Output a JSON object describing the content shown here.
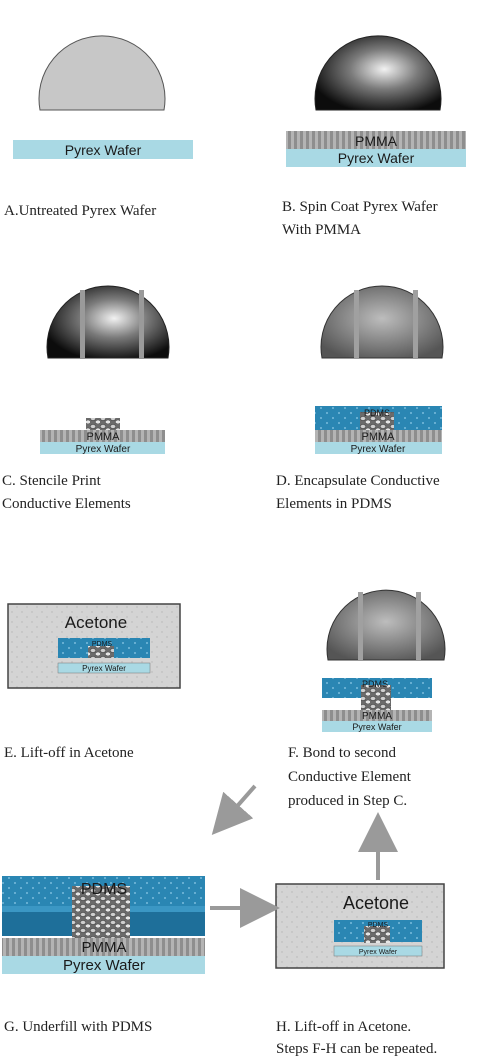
{
  "steps": [
    {
      "id": "A",
      "caption": [
        "A.Untreated Pyrex Wafer"
      ]
    },
    {
      "id": "B",
      "caption": [
        "B. Spin Coat Pyrex Wafer",
        "With PMMA"
      ]
    },
    {
      "id": "C",
      "caption": [
        "C. Stencile Print",
        "Conductive Elements"
      ]
    },
    {
      "id": "D",
      "caption": [
        "D. Encapsulate Conductive",
        "Elements in PDMS"
      ]
    },
    {
      "id": "E",
      "caption": [
        "E. Lift-off in Acetone"
      ]
    },
    {
      "id": "F",
      "caption": [
        "F. Bond to second",
        "Conductive Element",
        "produced in Step C."
      ]
    },
    {
      "id": "G",
      "caption": [
        "G. Underfill with PDMS"
      ]
    },
    {
      "id": "H",
      "caption": [
        "H. Lift-off in Acetone.",
        "Steps F-H can be repeated."
      ]
    }
  ],
  "layers": {
    "pyrex": "Pyrex Wafer",
    "pmma": "PMMA",
    "pdms": "PDMS",
    "acetone": "Acetone"
  },
  "colors": {
    "pyrex": "#a9d9e4",
    "pmma": "#a6a6a6",
    "pdms": "#2a86b3",
    "acetone_bath": "#d4d4d4"
  }
}
